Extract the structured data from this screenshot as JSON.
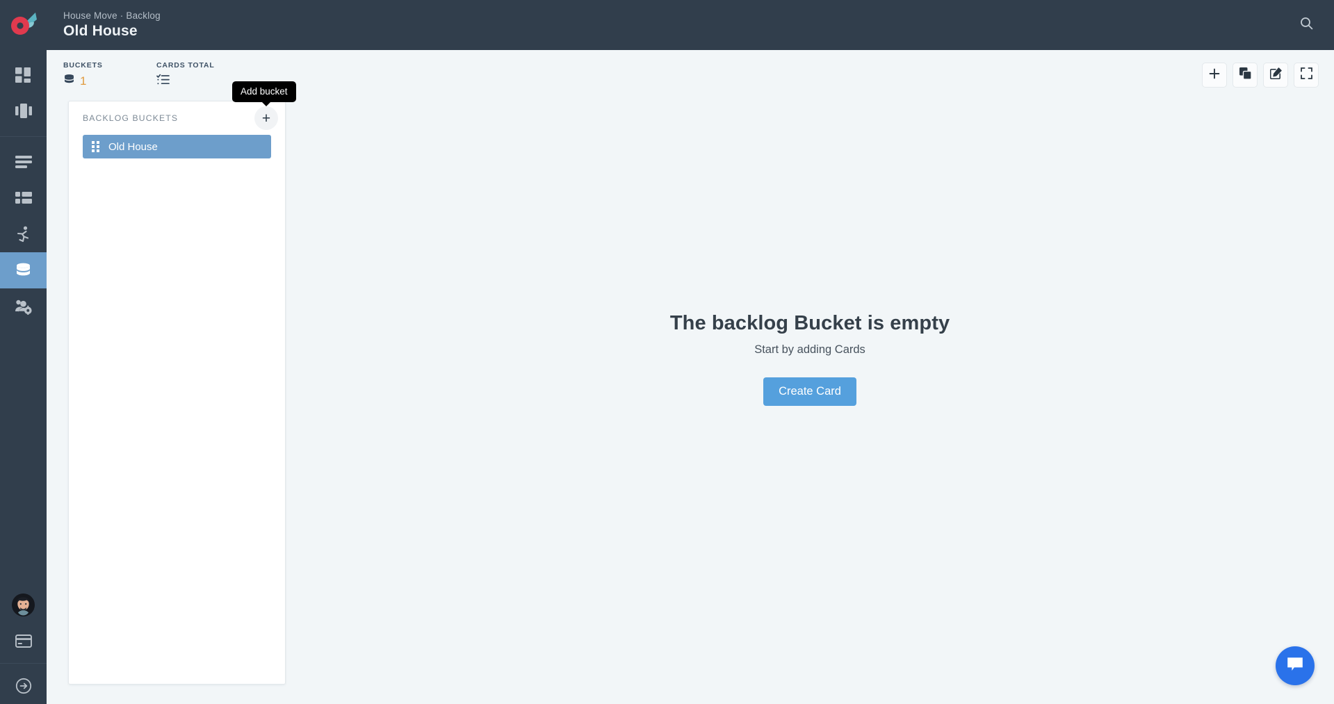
{
  "app": {
    "logo_icon": "kanban-app-logo",
    "brand_red": "#e03a4e",
    "brand_teal": "#64b6c4"
  },
  "header": {
    "breadcrumb": "House Move · Backlog",
    "title": "Old House",
    "search_icon": "search-icon"
  },
  "sidebar": {
    "groups": [
      {
        "items": [
          {
            "icon": "dashboard-grid-icon",
            "name": "sidebar-item-dashboard",
            "active": false
          },
          {
            "icon": "board-columns-icon",
            "name": "sidebar-item-boards",
            "active": false
          }
        ]
      },
      {
        "items": [
          {
            "icon": "list-lines-icon",
            "name": "sidebar-item-lists",
            "active": false
          },
          {
            "icon": "table-grid-icon",
            "name": "sidebar-item-table",
            "active": false
          },
          {
            "icon": "running-person-icon",
            "name": "sidebar-item-activity",
            "active": false
          },
          {
            "icon": "database-stack-icon",
            "name": "sidebar-item-backlog",
            "active": true
          },
          {
            "icon": "users-gear-icon",
            "name": "sidebar-item-team-settings",
            "active": false
          }
        ]
      }
    ],
    "bottom": [
      {
        "icon": "avatar",
        "name": "avatar"
      },
      {
        "icon": "credit-card-icon",
        "name": "sidebar-item-billing"
      },
      {
        "icon": "logout-arrow-icon",
        "name": "sidebar-item-logout"
      }
    ]
  },
  "stats": [
    {
      "label": "BUCKETS",
      "icon": "database-stack-icon",
      "value": "1"
    },
    {
      "label": "CARDS TOTAL",
      "icon": "checklist-icon",
      "value": ""
    }
  ],
  "toolbar": {
    "buttons": [
      {
        "name": "add-button",
        "icon": "plus-icon"
      },
      {
        "name": "duplicate-button",
        "icon": "copy-stack-icon"
      },
      {
        "name": "edit-button",
        "icon": "pencil-square-icon"
      },
      {
        "name": "fullscreen-button",
        "icon": "expand-corners-icon"
      }
    ]
  },
  "bucket_panel": {
    "title": "BACKLOG BUCKETS",
    "add_icon": "plus-icon",
    "buckets": [
      {
        "name": "Old House",
        "selected": true,
        "handle_icon": "drag-handle-icon"
      }
    ]
  },
  "tooltip": {
    "text": "Add bucket"
  },
  "empty_state": {
    "title": "The backlog Bucket is empty",
    "subtitle": "Start by adding Cards",
    "button_label": "Create Card",
    "button_color": "#55a0dd"
  },
  "chat": {
    "icon": "chat-bubble-icon",
    "color": "#2a72ea"
  }
}
